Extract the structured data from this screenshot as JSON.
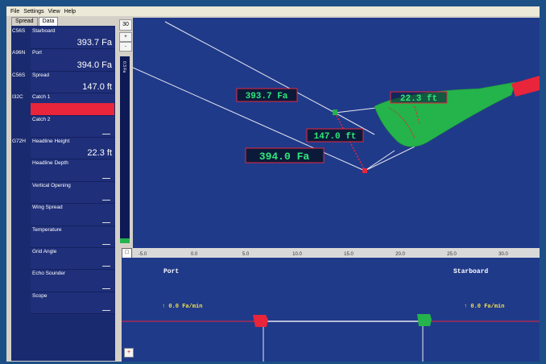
{
  "menu": [
    "File",
    "Settings",
    "View",
    "Help"
  ],
  "tabs": [
    "Spread",
    "Data"
  ],
  "left_panel": {
    "rows": [
      {
        "code": "C56S",
        "label": "Starboard",
        "value": "393.7 Fa",
        "kind": "value"
      },
      {
        "code": "A96N",
        "label": "Port",
        "value": "394.0 Fa",
        "kind": "value"
      },
      {
        "code": "C56S",
        "label": "Spread",
        "value": "147.0 ft",
        "kind": "value"
      },
      {
        "code": "I32C",
        "label": "Catch 1",
        "value": "",
        "kind": "alarm"
      },
      {
        "code": "",
        "label": "Catch 2",
        "value": "",
        "kind": "empty"
      },
      {
        "code": "G72H",
        "label": "Headline Height",
        "value": "22.3 ft",
        "kind": "value"
      },
      {
        "code": "",
        "label": "Headline Depth",
        "value": "",
        "kind": "empty"
      },
      {
        "code": "",
        "label": "Vertical Opening",
        "value": "",
        "kind": "empty"
      },
      {
        "code": "",
        "label": "Wing Spread",
        "value": "",
        "kind": "empty"
      },
      {
        "code": "",
        "label": "Temperature",
        "value": "",
        "kind": "empty"
      },
      {
        "code": "",
        "label": "Grid Angle",
        "value": "",
        "kind": "empty"
      },
      {
        "code": "",
        "label": "Echo Sounder",
        "value": "",
        "kind": "empty"
      },
      {
        "code": "",
        "label": "Scope",
        "value": "",
        "kind": "empty"
      }
    ]
  },
  "controls": {
    "zoom_value": "30",
    "plus": "+",
    "minus": "-",
    "scale_label": "0.3 Fa"
  },
  "main_view": {
    "starboard_readout": "393.7 Fa",
    "port_readout": "394.0 Fa",
    "spread_readout": "147.0 ft",
    "headline_readout": "22.3 ft"
  },
  "x_axis": {
    "ticks": [
      "-5.0",
      "0.0",
      "5.0",
      "10.0",
      "15.0",
      "20.0",
      "25.0",
      "30.0"
    ],
    "button": "□"
  },
  "lower_view": {
    "port_label": "Port",
    "starboard_label": "Starboard",
    "port_rate": "↑ 0.0 Fa/min",
    "starboard_rate": "↑ 0.0 Fa/min",
    "plus_button": "+"
  },
  "colors": {
    "accent_green": "#25b34c",
    "alarm_red": "#e8253a",
    "readout_green": "#2ee87a",
    "rate_yellow": "#f2e04a",
    "background_blue": "#203a8a"
  }
}
